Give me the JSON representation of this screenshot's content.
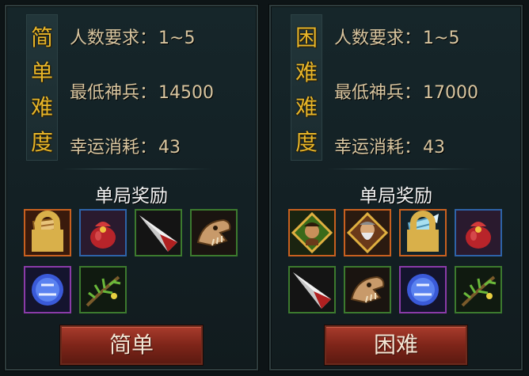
{
  "panels": [
    {
      "difficulty_label": [
        "简",
        "单",
        "难",
        "度"
      ],
      "players_label": "人数要求：",
      "players_value": "1~5",
      "power_label": "最低神兵：",
      "power_value": "14500",
      "luck_label": "幸运消耗：",
      "luck_value": "43",
      "reward_title": "单局奖励",
      "button_label": "简单",
      "rewards": [
        {
          "icon": "scroll-icon",
          "rarity": "orange",
          "locked": true
        },
        {
          "icon": "red-pouch-icon",
          "rarity": "blue",
          "locked": false
        },
        {
          "icon": "blade-icon",
          "rarity": "green",
          "locked": false
        },
        {
          "icon": "beast-skull-icon",
          "rarity": "green",
          "locked": false
        },
        {
          "icon": "blue-orb-icon",
          "rarity": "purple",
          "locked": false
        },
        {
          "icon": "herb-icon",
          "rarity": "green",
          "locked": false
        }
      ]
    },
    {
      "difficulty_label": [
        "困",
        "难",
        "难",
        "度"
      ],
      "players_label": "人数要求：",
      "players_value": "1~5",
      "power_label": "最低神兵：",
      "power_value": "17000",
      "luck_label": "幸运消耗：",
      "luck_value": "43",
      "reward_title": "单局奖励",
      "button_label": "困难",
      "rewards": [
        {
          "icon": "hero-card-icon",
          "rarity": "orange",
          "locked": false
        },
        {
          "icon": "elder-card-icon",
          "rarity": "orange",
          "locked": false
        },
        {
          "icon": "ice-scroll-icon",
          "rarity": "orange",
          "locked": true
        },
        {
          "icon": "red-pouch-icon",
          "rarity": "blue",
          "locked": false
        },
        {
          "icon": "blade-icon",
          "rarity": "green",
          "locked": false
        },
        {
          "icon": "beast-skull-icon",
          "rarity": "green",
          "locked": false
        },
        {
          "icon": "blue-orb-icon",
          "rarity": "purple",
          "locked": false
        },
        {
          "icon": "herb-icon",
          "rarity": "green",
          "locked": false
        }
      ]
    }
  ],
  "colors": {
    "title_gold": "#e6b52a",
    "info_text": "#d9c6a0",
    "button_red": "#8a2a1c"
  }
}
